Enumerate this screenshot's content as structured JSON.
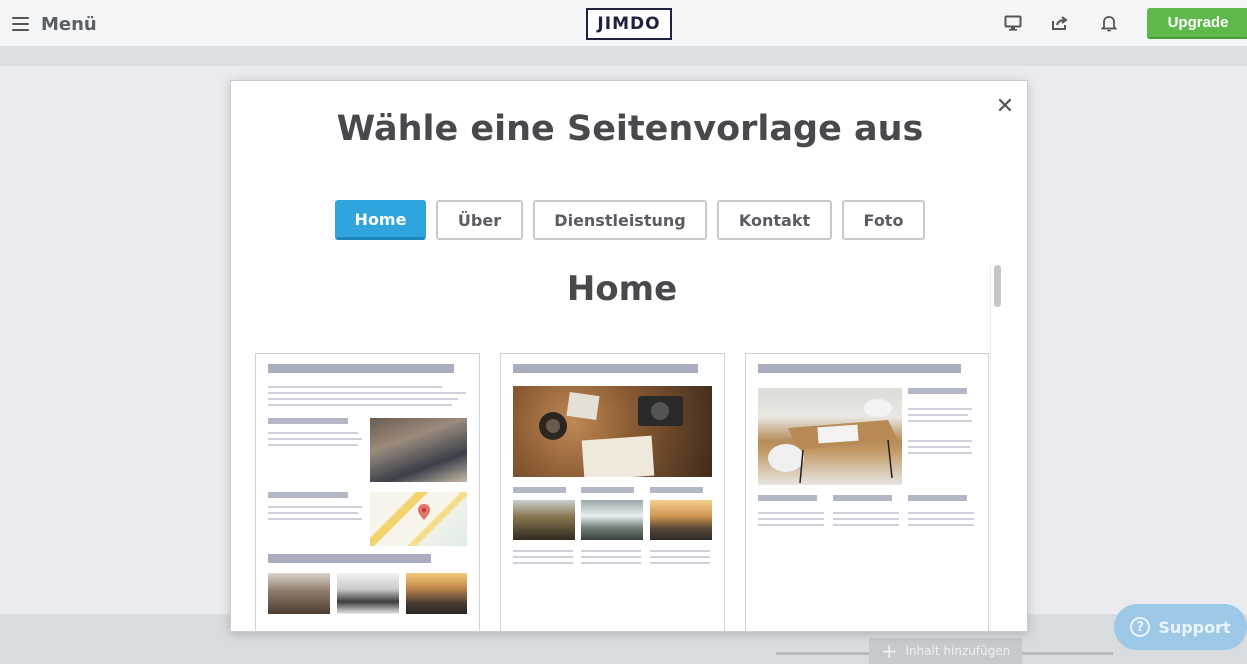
{
  "topbar": {
    "menu_label": "Menü",
    "logo_text": "JIMDO",
    "icons": [
      "desktop-icon",
      "share-icon",
      "bell-icon"
    ],
    "upgrade_label": "Upgrade"
  },
  "modal": {
    "title": "Wähle eine Seitenvorlage aus",
    "close_icon": "close-icon",
    "tabs": [
      {
        "label": "Home",
        "active": true
      },
      {
        "label": "Über",
        "active": false
      },
      {
        "label": "Dienstleistung",
        "active": false
      },
      {
        "label": "Kontakt",
        "active": false
      },
      {
        "label": "Foto",
        "active": false
      }
    ],
    "section_title": "Home",
    "templates": [
      {
        "name": "home-template-1",
        "images": [
          "meeting-photo",
          "map-image",
          "office-photo",
          "office-photo",
          "city-photo"
        ]
      },
      {
        "name": "home-template-2",
        "images": [
          "travel-photo",
          "road-photo",
          "waterfall-photo",
          "sunset-photo"
        ]
      },
      {
        "name": "home-template-3",
        "images": [
          "table-photo"
        ]
      }
    ]
  },
  "bottom": {
    "add_content_label": "Inhalt hinzufügen",
    "support_label": "Support"
  },
  "colors": {
    "accent_blue": "#2fa4dd",
    "upgrade_green": "#5fb84a",
    "support_blue": "#9dc8e8"
  }
}
